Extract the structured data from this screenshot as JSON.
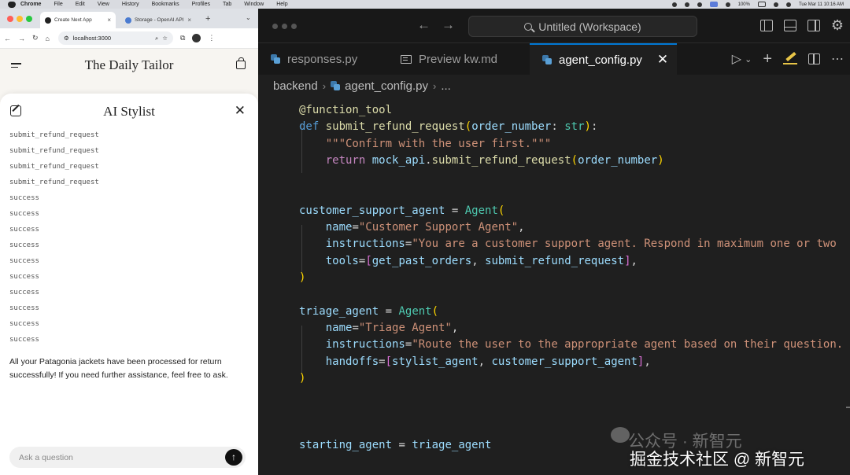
{
  "menubar": {
    "items": [
      "Chrome",
      "File",
      "Edit",
      "View",
      "History",
      "Bookmarks",
      "Profiles",
      "Tab",
      "Window",
      "Help"
    ],
    "battery": "100%",
    "clock": "Tue Mar 11  10:16 AM"
  },
  "browser": {
    "tabs": [
      {
        "label": "Create Next App",
        "favicon_color": "#222222"
      },
      {
        "label": "Storage - OpenAI API",
        "favicon_color": "#4a7bd0"
      }
    ],
    "new_tab": "+",
    "tab_menu": "⌄",
    "url": "localhost:3000",
    "colors": {
      "window_bg": "#f7f5f1",
      "tabstrip": "#dee1e6"
    }
  },
  "site": {
    "title": "The Daily Tailor"
  },
  "chat": {
    "title": "AI Stylist",
    "log_lines": [
      "submit_refund_request",
      "submit_refund_request",
      "submit_refund_request",
      "submit_refund_request",
      "success",
      "success",
      "success",
      "success",
      "success",
      "success",
      "success",
      "success",
      "success",
      "success"
    ],
    "answer": "All your Patagonia jackets have been processed for return successfully! If you need further assistance, feel free to ask.",
    "input_placeholder": "Ask a question",
    "send_icon": "arrow-up-icon"
  },
  "editor": {
    "search_title": "Untitled (Workspace)",
    "tabs": [
      {
        "label": "responses.py",
        "icon": "python-icon"
      },
      {
        "label": "Preview kw.md",
        "icon": "markdown-preview-icon"
      },
      {
        "label": "agent_config.py",
        "icon": "python-icon"
      }
    ],
    "breadcrumb": [
      "backend",
      "agent_config.py",
      "..."
    ],
    "colors": {
      "bg": "#1f1f1f",
      "titlebar": "#181818",
      "accent": "#0078d4"
    },
    "code_lines": [
      "@function_tool",
      "def submit_refund_request(order_number: str):",
      "    \"\"\"Confirm with the user first.\"\"\"",
      "    return mock_api.submit_refund_request(order_number)",
      "",
      "",
      "customer_support_agent = Agent(",
      "    name=\"Customer Support Agent\",",
      "    instructions=\"You are a customer support agent. Respond in maximum one or two",
      "    tools=[get_past_orders, submit_refund_request],",
      ")",
      "",
      "triage_agent = Agent(",
      "    name=\"Triage Agent\",",
      "    instructions=\"Route the user to the appropriate agent based on their question.",
      "    handoffs=[stylist_agent, customer_support_agent],",
      ")",
      "",
      "",
      "",
      "starting_agent = triage_agent"
    ]
  },
  "watermark": {
    "top": "公众号 · 新智元",
    "bottom": "掘金技术社区 @ 新智元"
  }
}
